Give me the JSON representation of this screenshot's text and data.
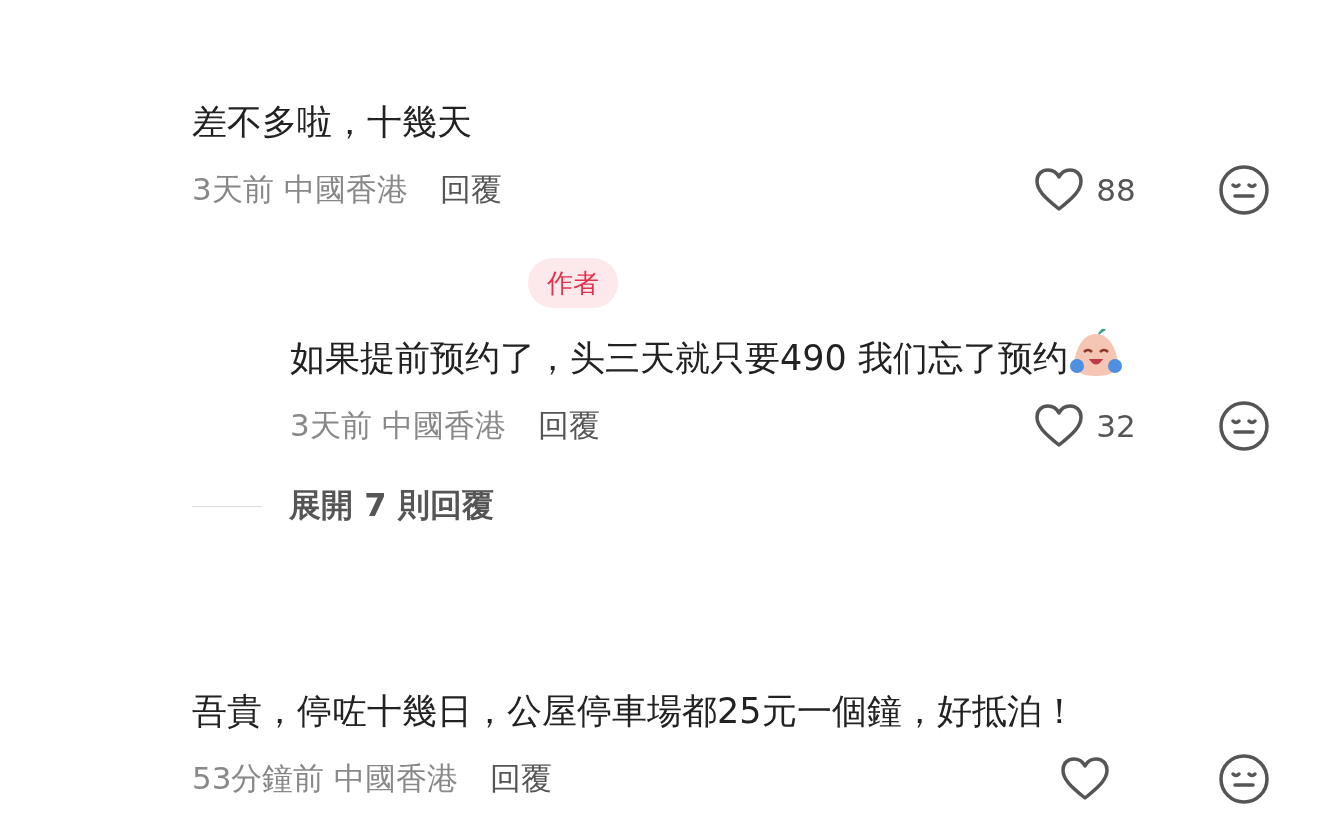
{
  "comments": [
    {
      "text": "差不多啦，十幾天",
      "time": "3天前",
      "location": "中國香港",
      "reply_label": "回覆",
      "likes": "88",
      "replies": [
        {
          "badge": "作者",
          "text": "如果提前预约了，头三天就只要490 我们忘了预约",
          "has_emoji": true,
          "time": "3天前",
          "location": "中國香港",
          "reply_label": "回覆",
          "likes": "32"
        }
      ],
      "more_replies": "展開 7 則回覆"
    },
    {
      "text": "吾貴，停咗十幾日，公屋停車場都25元一個鐘，好抵泊！",
      "time": "53分鐘前",
      "location": "中國香港",
      "reply_label": "回覆"
    }
  ]
}
